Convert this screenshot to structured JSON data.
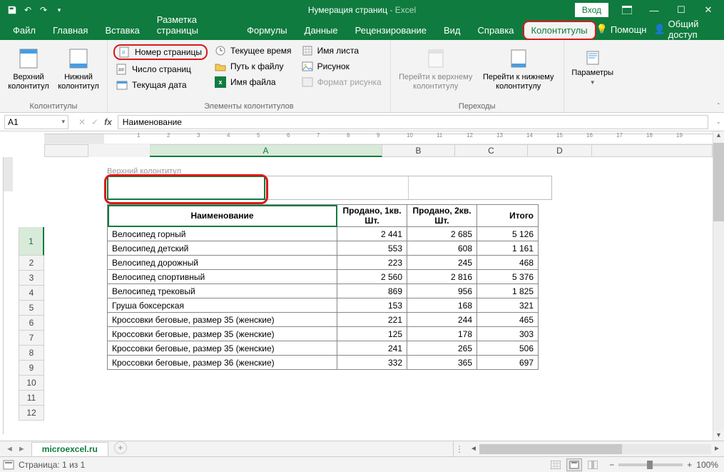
{
  "title": {
    "main": "Нумерация страниц",
    "sub": " -  Excel"
  },
  "login": "Вход",
  "tabs": {
    "file": "Файл",
    "home": "Главная",
    "insert": "Вставка",
    "layout": "Разметка страницы",
    "formulas": "Формулы",
    "data": "Данные",
    "review": "Рецензирование",
    "view": "Вид",
    "help": "Справка",
    "hf": "Колонтитулы",
    "tellme": "Помощн",
    "share": "Общий доступ"
  },
  "ribbon": {
    "group_hf": "Колонтитулы",
    "header": "Верхний колонтитул",
    "footer": "Нижний колонтитул",
    "group_elem": "Элементы колонтитулов",
    "page_num": "Номер страницы",
    "page_count": "Число страниц",
    "cur_date": "Текущая дата",
    "cur_time": "Текущее время",
    "file_path": "Путь к файлу",
    "file_name": "Имя файла",
    "sheet_name": "Имя листа",
    "picture": "Рисунок",
    "fmt_picture": "Формат рисунка",
    "group_nav": "Переходы",
    "goto_header": "Перейти к верхнему колонтитулу",
    "goto_footer": "Перейти к нижнему колонтитулу",
    "group_opt": "Параметры"
  },
  "namebox": "A1",
  "formula": "Наименование",
  "cols": {
    "A": "A",
    "B": "B",
    "C": "C",
    "D": "D"
  },
  "page_layout_hint": "Верхний колонтитул",
  "table": {
    "h_name": "Наименование",
    "h_q1": "Продано, 1кв. Шт.",
    "h_q2": "Продано, 2кв. Шт.",
    "h_tot": "Итого",
    "rows": [
      {
        "n": "Велосипед горный",
        "q1": "2 441",
        "q2": "2 685",
        "t": "5 126"
      },
      {
        "n": "Велосипед детский",
        "q1": "553",
        "q2": "608",
        "t": "1 161"
      },
      {
        "n": "Велосипед дорожный",
        "q1": "223",
        "q2": "245",
        "t": "468"
      },
      {
        "n": "Велосипед спортивный",
        "q1": "2 560",
        "q2": "2 816",
        "t": "5 376"
      },
      {
        "n": "Велосипед трековый",
        "q1": "869",
        "q2": "956",
        "t": "1 825"
      },
      {
        "n": "Груша боксерская",
        "q1": "153",
        "q2": "168",
        "t": "321"
      },
      {
        "n": "Кроссовки беговые, размер 35 (женские)",
        "q1": "221",
        "q2": "244",
        "t": "465"
      },
      {
        "n": "Кроссовки беговые, размер 35 (женские)",
        "q1": "125",
        "q2": "178",
        "t": "303"
      },
      {
        "n": "Кроссовки беговые, размер 35 (женские)",
        "q1": "241",
        "q2": "265",
        "t": "506"
      },
      {
        "n": "Кроссовки беговые, размер 36 (женские)",
        "q1": "332",
        "q2": "365",
        "t": "697"
      }
    ]
  },
  "row_nums": [
    "1",
    "2",
    "3",
    "4",
    "5",
    "6",
    "7",
    "8",
    "9",
    "10",
    "11",
    "12"
  ],
  "sheet_tab": "microexcel.ru",
  "status_page": "Страница: 1 из 1",
  "zoom_pct": "100%",
  "ruler_ticks": [
    "1",
    "2",
    "3",
    "4",
    "5",
    "6",
    "7",
    "8",
    "9",
    "10",
    "11",
    "12",
    "13",
    "14",
    "15",
    "16",
    "17",
    "18",
    "19"
  ]
}
